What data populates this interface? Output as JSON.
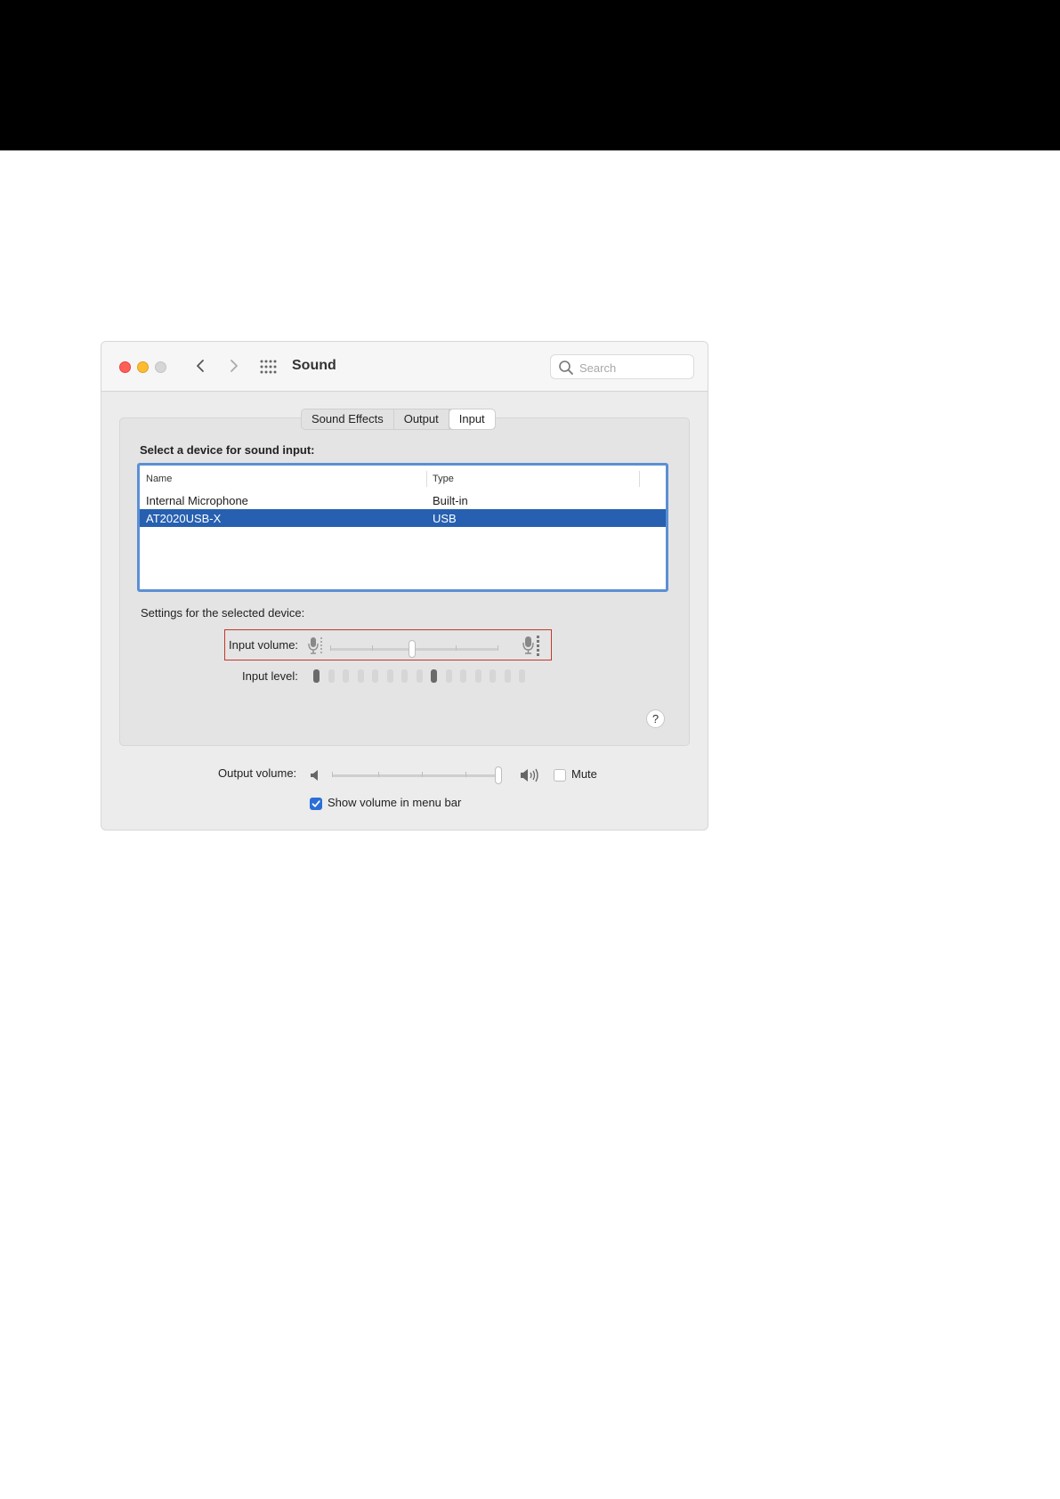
{
  "window": {
    "title": "Sound"
  },
  "search": {
    "placeholder": "Search"
  },
  "tabs": [
    {
      "label": "Sound Effects",
      "active": false
    },
    {
      "label": "Output",
      "active": false
    },
    {
      "label": "Input",
      "active": true
    }
  ],
  "input_tab": {
    "device_heading": "Select a device for sound input:",
    "table": {
      "columns": [
        "Name",
        "Type"
      ],
      "rows": [
        {
          "name": "Internal Microphone",
          "type": "Built-in",
          "selected": false
        },
        {
          "name": "AT2020USB-X",
          "type": "USB",
          "selected": true
        }
      ]
    },
    "settings_heading": "Settings for the selected device:",
    "input_volume_label": "Input volume:",
    "input_volume_fraction": 0.49,
    "input_level_label": "Input level:",
    "input_level_bars_total": 15,
    "input_level_bars_active": 9
  },
  "output": {
    "output_volume_label": "Output volume:",
    "output_volume_fraction": 1.0,
    "mute_label": "Mute",
    "mute_checked": false,
    "menu_bar_label": "Show volume in menu bar",
    "menu_bar_checked": true
  },
  "help": {
    "label": "?"
  },
  "colors": {
    "selection": "#2760b0",
    "accent": "#2b6fd6",
    "highlight_box": "#c0392b",
    "close": "#ff5f57",
    "minimize": "#febc2e"
  }
}
